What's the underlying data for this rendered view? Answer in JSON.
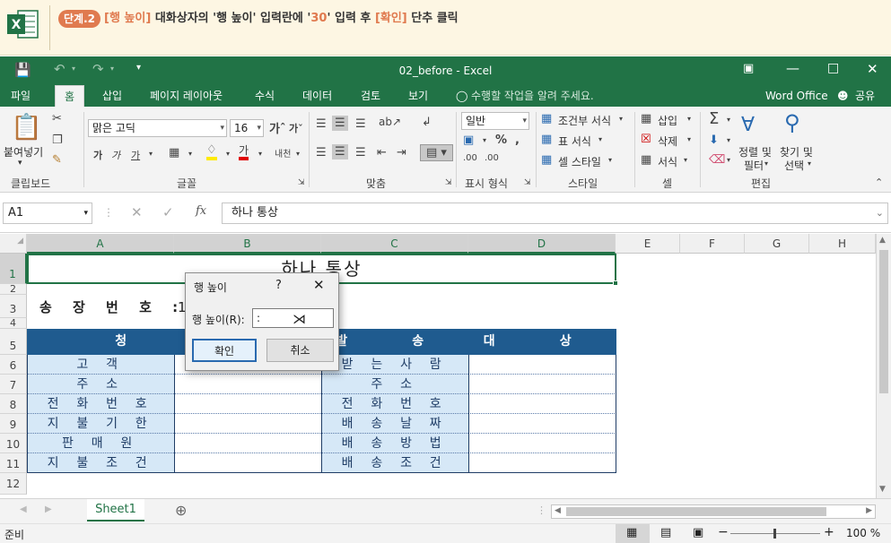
{
  "banner": {
    "step_label": "단계.2",
    "instr_bracket1": "[행 높이]",
    "instr_part1": " 대화상자의 '행 높이' 입력란에 '",
    "instr_value": "30",
    "instr_part2": "' 입력 후 ",
    "instr_bracket2": "[확인]",
    "instr_part3": " 단추 클릭"
  },
  "window": {
    "title": "02_before  -  Excel"
  },
  "menu": {
    "items": [
      "파일",
      "홈",
      "삽입",
      "페이지 레이아웃",
      "수식",
      "데이터",
      "검토",
      "보기"
    ],
    "tell_me": "수행할 작업을 알려 주세요.",
    "account": "Word Office",
    "share": "공유"
  },
  "ribbon": {
    "paste": "붙여넣기",
    "font_name": "맑은 고딕",
    "font_size": "16",
    "number_format": "일반",
    "conditional": "조건부 서식",
    "table_format": "표 서식",
    "cell_style": "셀 스타일",
    "insert": "삽입",
    "delete": "삭제",
    "format": "서식",
    "sort_filter": [
      "정렬 및",
      "필터"
    ],
    "find_select": [
      "찾기 및",
      "선택"
    ],
    "groups": [
      "클립보드",
      "글꼴",
      "맞춤",
      "표시 형식",
      "스타일",
      "셀",
      "편집"
    ]
  },
  "formula_bar": {
    "name_box": "A1",
    "formula": "하나 통상",
    "fx": "fx"
  },
  "columns": [
    "A",
    "B",
    "C",
    "D",
    "E",
    "F",
    "G",
    "H"
  ],
  "rows": [
    "1",
    "2",
    "3",
    "4",
    "5",
    "6",
    "7",
    "8",
    "9",
    "10",
    "11",
    "12"
  ],
  "sheet": {
    "title": "하나 통상",
    "invoice_label": "송 장 번 호 :",
    "invoice_value": "1",
    "header_left": "청 구",
    "header_ship": "발 송",
    "header_target": "대 상",
    "left_labels": [
      "고객",
      "주소",
      "전화번호",
      "지불기한",
      "판매원",
      "지불조건"
    ],
    "right_labels": [
      "받는사람",
      "주소",
      "전화번호",
      "배송날짜",
      "배송방법",
      "배송조건"
    ]
  },
  "dialog": {
    "title": "행 높이",
    "help": "?",
    "field_label": "행 높이(R):",
    "field_value": ":",
    "ok": "확인",
    "cancel": "취소"
  },
  "tabs": {
    "sheet": "Sheet1"
  },
  "status": {
    "ready": "준비",
    "zoom": "100 %"
  }
}
